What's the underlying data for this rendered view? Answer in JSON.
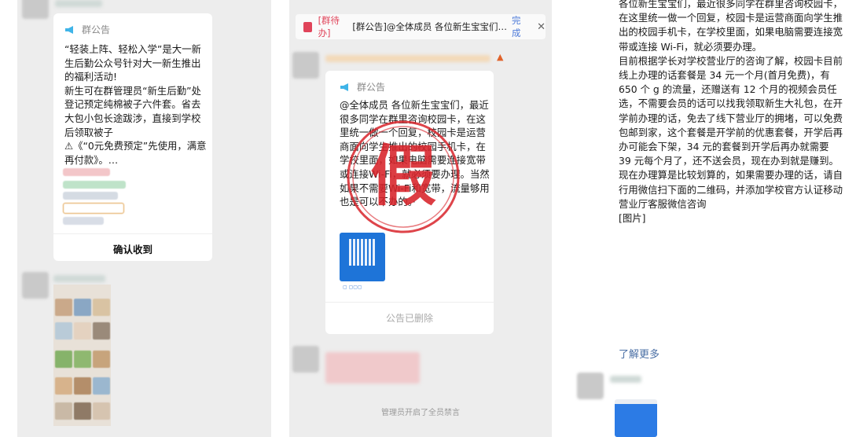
{
  "panel1": {
    "card": {
      "title": "群公告",
      "text": "“轻装上阵、轻松入学”是大一新生后勤公众号针对大一新生推出的福利活动!\n新生可在群管理员“新生后勤”处登记预定纯棉被子六件套。省去大包小包长途跋涉，直接到学校后领取被子\n⚠《“0元免费预定”先使用，满意再付款》。…",
      "confirm": "确认收到"
    }
  },
  "panel2": {
    "banner": {
      "tag": "[群待办]",
      "text": "[群公告]@全体成员 各位新生宝宝们…",
      "done": "完成",
      "close": "✕"
    },
    "card": {
      "title": "群公告",
      "text": "@全体成员 各位新生宝宝们，最近很多同学在群里咨询校园卡，在这里统一做一个回复，校园卡是运营商面向学生推出的校园手机卡，在学校里面，如果电脑需要连接宽带或连接Wi-Fi，就必须要办理。当然如果不需要Wi-Fi和宽带，流量够用也是可以不办的。·",
      "deleted": "公告已删除"
    },
    "stamp_text": "假",
    "mute_note": "管理员开启了全员禁言"
  },
  "panel3": {
    "text": "各位新生宝宝们，最近很多同学在群里咨询校园卡，在这里统一做一个回复，校园卡是运营商面向学生推出的校园手机卡，在学校里面，如果电脑需要连接宽带或连接 Wi-Fi，就必须要办理。\n目前根据学长对学校营业厅的咨询了解，校园卡目前线上办理的话套餐是 34 元一个月(首月免费)，有 650 个 g 的流量，还赠送有 12 个月的视频会员任选，不需要会员的话可以找我领取新生大礼包，在开学前办理的话，免去了线下营业厅的拥堵，可以免费包邮到家，这个套餐是开学前的优惠套餐，开学后再办可能会下架，34 元的套餐到开学后再办就需要 39 元每个月了，还不送会员，现在办到就是赚到。\n现在办理算是比较划算的，如果需要办理的话，请自行用微信扫下面的二维码，并添加学校官方认证移动营业厅客服微信咨询\n[图片]",
    "more": "了解更多"
  },
  "colors": {
    "accent_blue": "#4a78d8",
    "todo_red": "#e0445a",
    "stamp_red": "#d8232a"
  }
}
